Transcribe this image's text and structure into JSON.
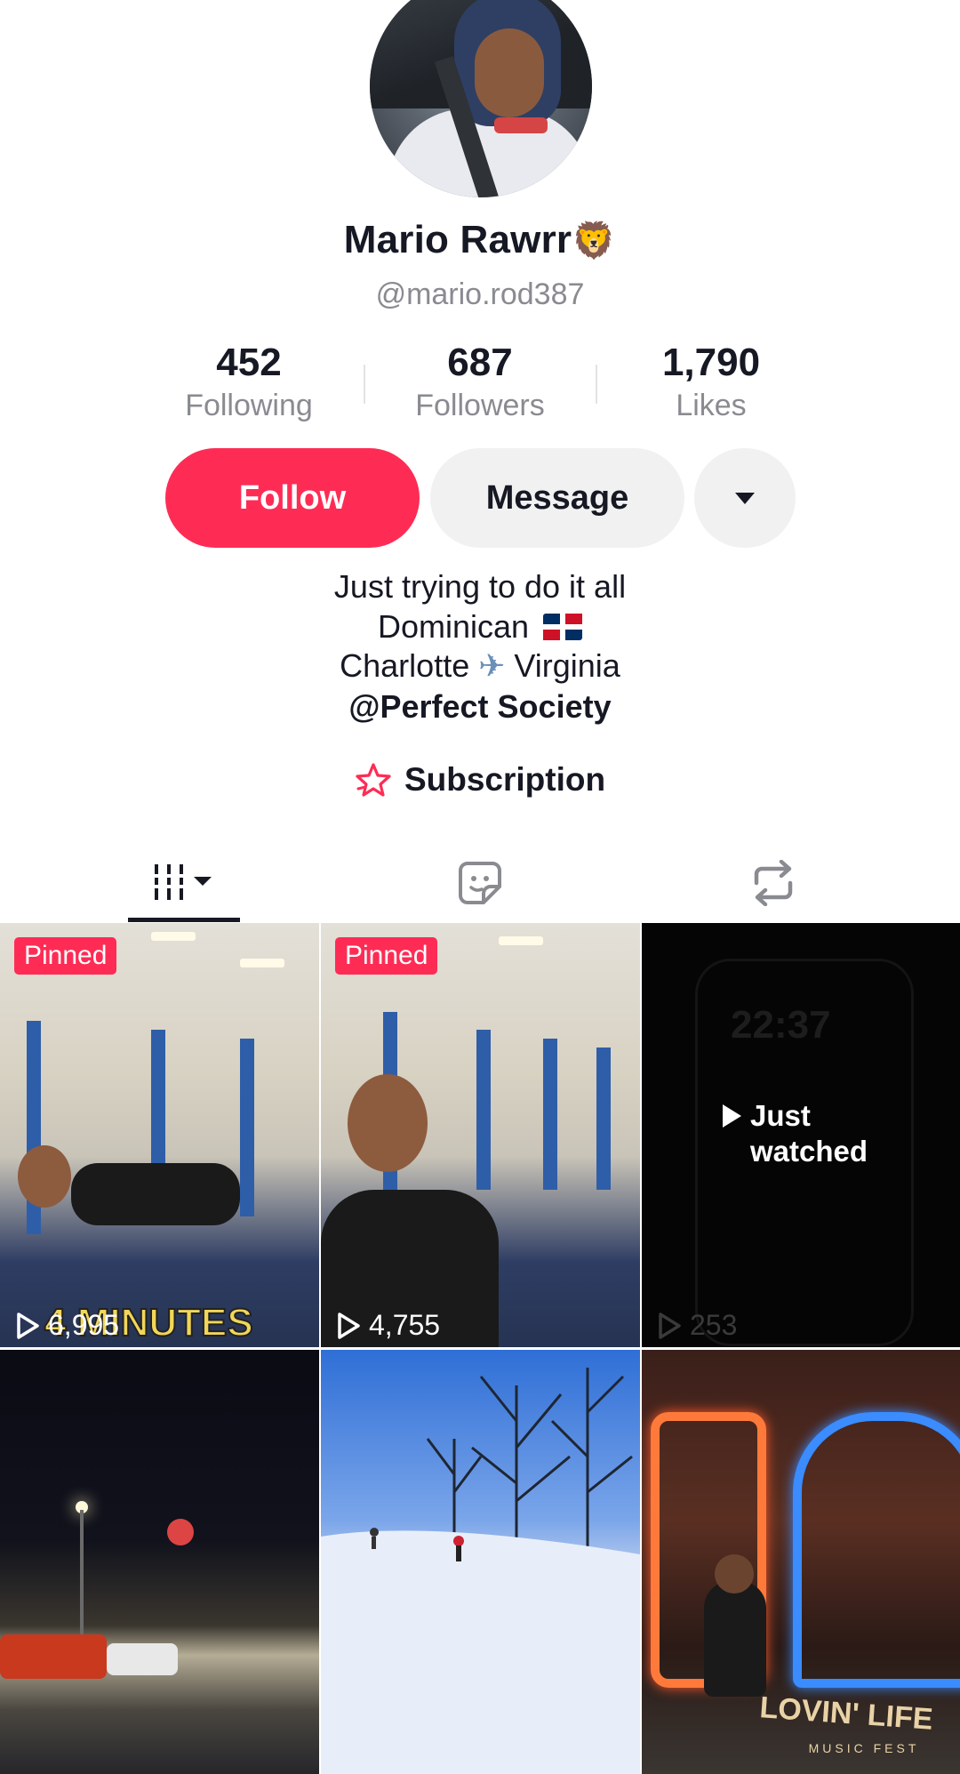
{
  "profile": {
    "display_name": "Mario Rawrr",
    "name_emoji": "🦁",
    "username": "@mario.rod387",
    "stats": [
      {
        "value": "452",
        "label": "Following"
      },
      {
        "value": "687",
        "label": "Followers"
      },
      {
        "value": "1,790",
        "label": "Likes"
      }
    ],
    "actions": {
      "follow": "Follow",
      "message": "Message"
    },
    "bio": {
      "line1": "Just trying to do it all",
      "line2": "Dominican",
      "line3_a": "Charlotte",
      "line3_plane": "✈",
      "line3_b": "Virginia",
      "link": "@Perfect Society"
    },
    "subscription": "Subscription"
  },
  "tabs": [
    "videos-grid-icon",
    "liked-sticker-icon",
    "repost-icon"
  ],
  "videos": [
    {
      "badge": "Pinned",
      "views": "6,995",
      "overlay_text": "4 MINUTES"
    },
    {
      "badge": "Pinned",
      "views": "4,755"
    },
    {
      "status_label_1": "Just",
      "status_label_2": "watched",
      "views": "253",
      "phone_clock": "22:37"
    },
    {
      "views": ""
    },
    {
      "views": ""
    },
    {
      "views": "",
      "sign_text": "LOVIN' LIFE",
      "sign_sub": "MUSIC FEST"
    }
  ],
  "colors": {
    "accent": "#fe2c55",
    "secondary_button": "#f1f1f2",
    "muted_text": "#8a8b91"
  }
}
